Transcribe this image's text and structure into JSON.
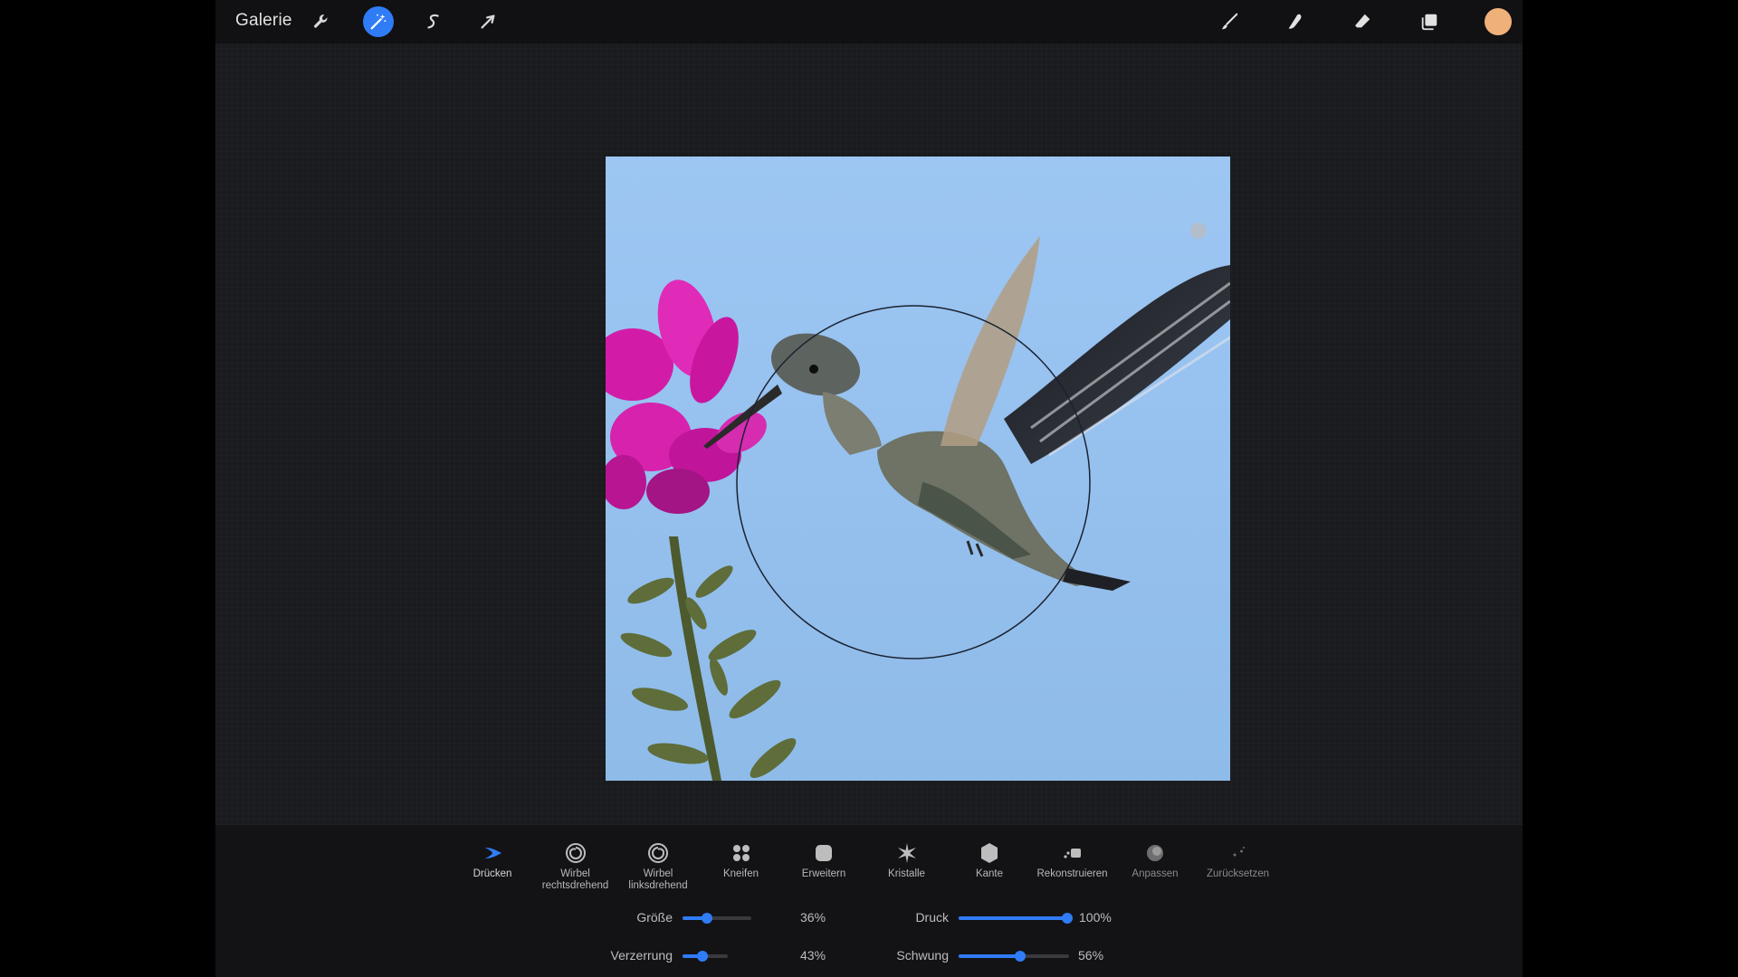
{
  "toolbar": {
    "gallery_label": "Galerie",
    "left_tools": [
      {
        "name": "actions",
        "icon": "wrench-icon",
        "active": false
      },
      {
        "name": "adjustments",
        "icon": "magic-wand-icon",
        "active": true
      },
      {
        "name": "selection",
        "icon": "selection-s-icon",
        "active": false
      },
      {
        "name": "transform",
        "icon": "arrow-cursor-icon",
        "active": false
      }
    ],
    "right_tools": [
      {
        "name": "brush",
        "icon": "paintbrush-icon"
      },
      {
        "name": "smudge",
        "icon": "smudge-finger-icon"
      },
      {
        "name": "eraser",
        "icon": "eraser-icon"
      },
      {
        "name": "layers",
        "icon": "layers-icon"
      }
    ],
    "color": "#f0b07a",
    "accent": "#2f7cf6"
  },
  "canvas": {
    "image_subject": "hummingbird-flower-photo",
    "sky_color": "#9cc6f2"
  },
  "liquify": {
    "modes": [
      {
        "label": "Drücken",
        "icon": "push-icon",
        "selected": true
      },
      {
        "label": "Wirbel\nrechtsdrehend",
        "icon": "twirl-right-icon",
        "selected": false
      },
      {
        "label": "Wirbel\nlinksdrehend",
        "icon": "twirl-left-icon",
        "selected": false
      },
      {
        "label": "Kneifen",
        "icon": "pinch-icon",
        "selected": false
      },
      {
        "label": "Erweitern",
        "icon": "expand-icon",
        "selected": false
      },
      {
        "label": "Kristalle",
        "icon": "crystals-icon",
        "selected": false
      },
      {
        "label": "Kante",
        "icon": "edge-icon",
        "selected": false
      },
      {
        "label": "Rekonstruieren",
        "icon": "reconstruct-icon",
        "selected": false
      },
      {
        "label": "Anpassen",
        "icon": "adjust-icon",
        "selected": false
      },
      {
        "label": "Zurücksetzen",
        "icon": "reset-icon",
        "selected": false
      }
    ],
    "sliders": {
      "size": {
        "label": "Größe",
        "value": 0.36,
        "text": "36%"
      },
      "distortion": {
        "label": "Verzerrung",
        "value": 0.43,
        "text": "43%"
      },
      "pressure": {
        "label": "Druck",
        "value": 1.0,
        "text": "100%"
      },
      "momentum": {
        "label": "Schwung",
        "value": 0.56,
        "text": "56%"
      }
    }
  }
}
